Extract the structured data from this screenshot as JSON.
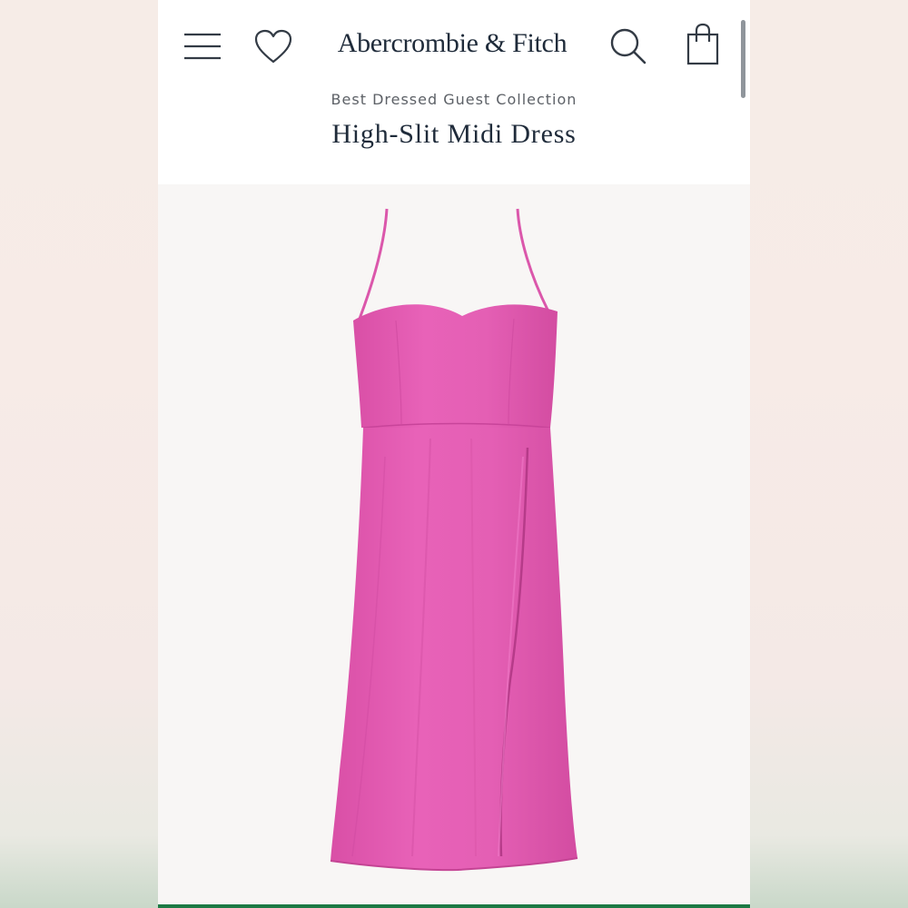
{
  "header": {
    "brand": "Abercrombie & Fitch",
    "icons": {
      "menu": "hamburger-menu-icon",
      "wishlist": "heart-icon",
      "search": "search-icon",
      "bag": "shopping-bag-icon"
    }
  },
  "product": {
    "collection": "Best Dressed Guest Collection",
    "title": "High-Slit Midi Dress",
    "image": {
      "subject": "pink-spaghetti-strap-midi-dress",
      "color": "#e45fb4",
      "background": "#f8f6f5"
    }
  },
  "colors": {
    "text_primary": "#1f2b3a",
    "text_secondary": "#5d6167",
    "accent_bottom": "#1c7a44"
  }
}
